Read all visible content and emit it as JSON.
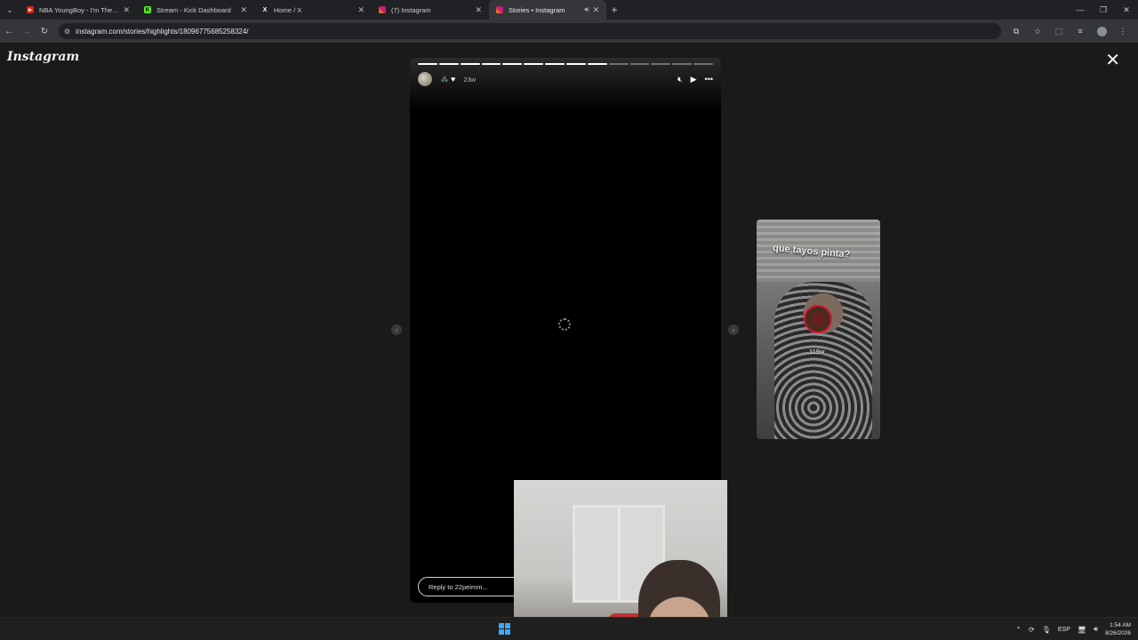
{
  "browser": {
    "tabs": [
      {
        "title": "NBA YoungBoy - I'm The One",
        "favicon": "youtube-icon",
        "active": false
      },
      {
        "title": "Stream - Kick Dashboard",
        "favicon": "kick-icon",
        "active": false
      },
      {
        "title": "Home / X",
        "favicon": "x-icon",
        "active": false
      },
      {
        "title": "(7) Instagram",
        "favicon": "instagram-icon",
        "active": false
      },
      {
        "title": "Stories • Instagram",
        "favicon": "instagram-icon",
        "active": true
      }
    ],
    "url": "instagram.com/stories/highlights/18096775685258324/"
  },
  "page": {
    "logo": "Instagram",
    "story": {
      "age": "23w",
      "progress_total": 14,
      "progress_done": 9,
      "reply_placeholder": "Reply to 22peimm..."
    },
    "next_story": {
      "caption": "que tayos pinta?",
      "age": "119w"
    }
  },
  "taskbar": {
    "language": "ESP",
    "time": "1:54 AM",
    "date": "8/26/2026"
  },
  "colors": {
    "page_bg": "#1a1a1a",
    "story_bg": "#000000",
    "accent_windows": "#3fa9f5"
  }
}
